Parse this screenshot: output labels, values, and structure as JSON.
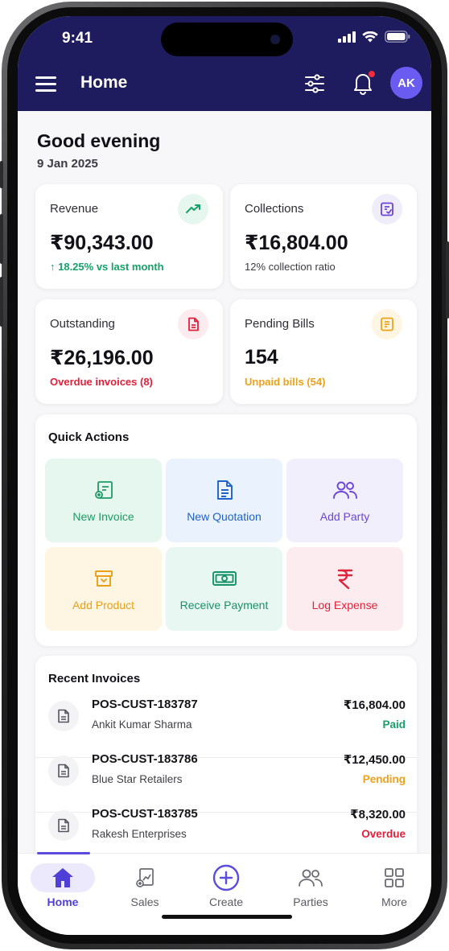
{
  "status_bar": {
    "time": "9:41"
  },
  "header": {
    "title": "Home",
    "avatar_initials": "AK"
  },
  "greeting": {
    "text": "Good evening",
    "date": "9 Jan 2025"
  },
  "stats": [
    {
      "label": "Revenue",
      "value": "₹90,343.00",
      "sub": "↑ 18.25% vs last month",
      "sub_color": "#16a06a",
      "icon": "trending-up-icon"
    },
    {
      "label": "Collections",
      "value": "₹16,804.00",
      "sub": "12% collection ratio",
      "sub_color": "#3b3b45",
      "icon": "receipt-icon"
    },
    {
      "label": "Outstanding",
      "value": "₹26,196.00",
      "sub": "Overdue invoices (8)",
      "sub_color": "#e1213b",
      "icon": "document-icon"
    },
    {
      "label": "Pending Bills",
      "value": "154",
      "sub": "Unpaid bills (54)",
      "sub_color": "#eea21a",
      "icon": "bill-icon"
    }
  ],
  "quick_actions": {
    "title": "Quick Actions",
    "items": [
      {
        "label": "New Invoice",
        "color": "#1f9a65",
        "bg": "#e6f7ef",
        "icon": "invoice-icon"
      },
      {
        "label": "New Quotation",
        "color": "#1f63c9",
        "bg": "#e9f2fd",
        "icon": "quotation-icon"
      },
      {
        "label": "Add Party",
        "color": "#6a45d8",
        "bg": "#f2effd",
        "icon": "users-icon"
      },
      {
        "label": "Add Product",
        "color": "#e8a019",
        "bg": "#fef5e3",
        "icon": "box-icon"
      },
      {
        "label": "Receive Payment",
        "color": "#16926a",
        "bg": "#e9f7f2",
        "icon": "cash-icon"
      },
      {
        "label": "Log Expense",
        "color": "#e0233c",
        "bg": "#fdecef",
        "icon": "rupee-icon"
      }
    ]
  },
  "recent_invoices": {
    "title": "Recent Invoices",
    "rows": [
      {
        "number": "POS-CUST-183787",
        "party": "Ankit Kumar Sharma",
        "amount": "₹16,804.00",
        "status": "Paid",
        "status_color": "#16a06a"
      },
      {
        "number": "POS-CUST-183786",
        "party": "Blue Star Retailers",
        "amount": "₹12,450.00",
        "status": "Pending",
        "status_color": "#eea21a"
      },
      {
        "number": "POS-CUST-183785",
        "party": "Rakesh Enterprises",
        "amount": "₹8,320.00",
        "status": "Overdue",
        "status_color": "#e1213b"
      }
    ]
  },
  "bottom_nav": {
    "active": "Home",
    "items": [
      {
        "label": "Home",
        "icon": "home-icon"
      },
      {
        "label": "Sales",
        "icon": "sales-icon"
      },
      {
        "label": "Create",
        "icon": "plus-circle-icon"
      },
      {
        "label": "Parties",
        "icon": "users-icon"
      },
      {
        "label": "More",
        "icon": "grid-icon"
      }
    ]
  }
}
